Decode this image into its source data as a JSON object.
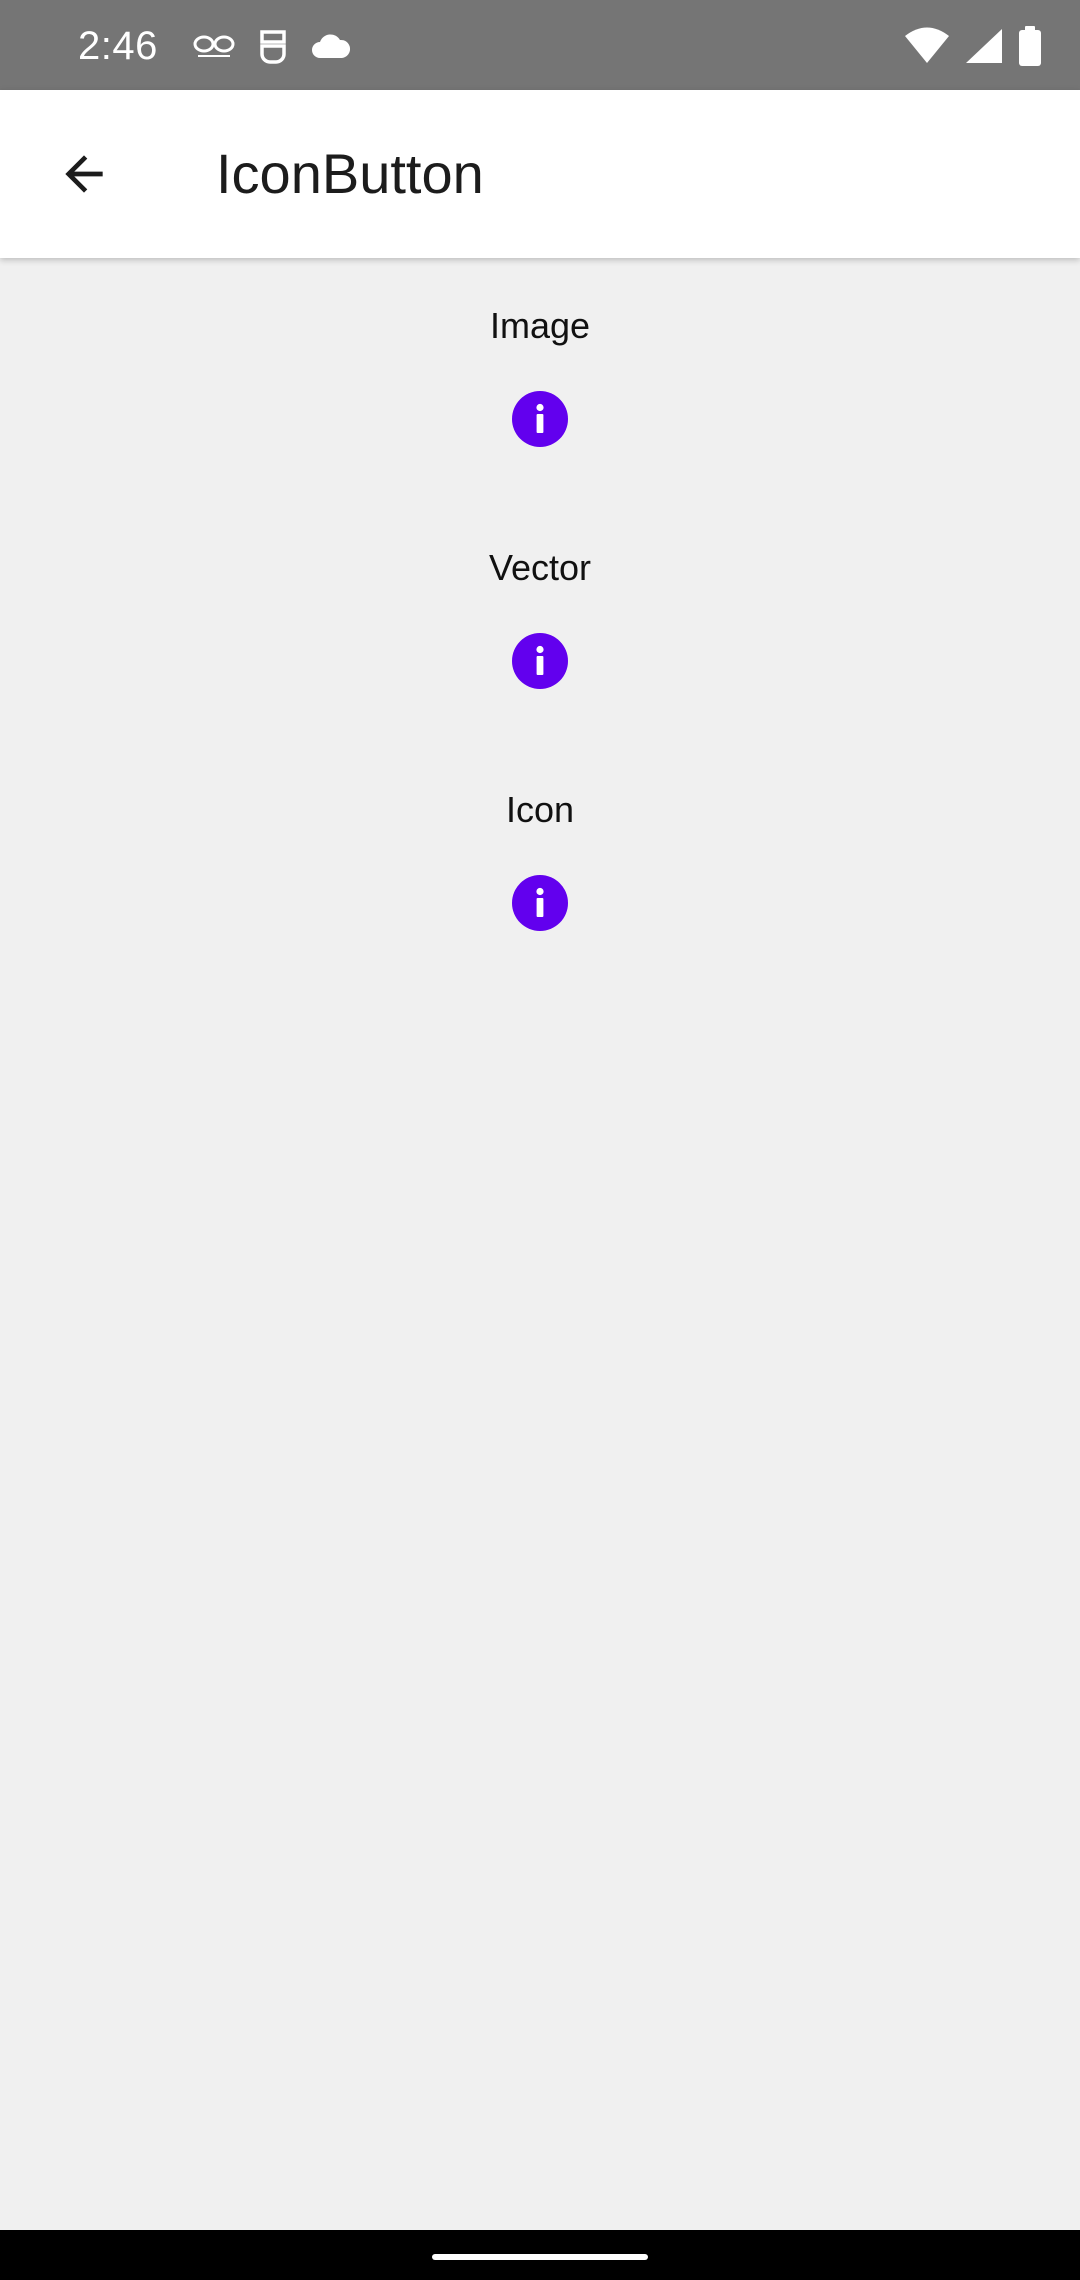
{
  "status_bar": {
    "time": "2:46",
    "left_icons": [
      "link-notification-icon",
      "secure-box-icon",
      "cloud-icon"
    ],
    "right_icons": [
      "wifi-icon",
      "cell-signal-icon",
      "battery-icon"
    ]
  },
  "app_bar": {
    "title": "IconButton",
    "back_icon": "arrow-back-icon"
  },
  "sections": [
    {
      "label": "Image",
      "icon": "info-icon"
    },
    {
      "label": "Vector",
      "icon": "info-icon"
    },
    {
      "label": "Icon",
      "icon": "info-icon"
    }
  ],
  "colors": {
    "accent": "#6200ee",
    "status_bar": "#757575",
    "background": "#f0f0f0",
    "app_bar": "#ffffff"
  }
}
